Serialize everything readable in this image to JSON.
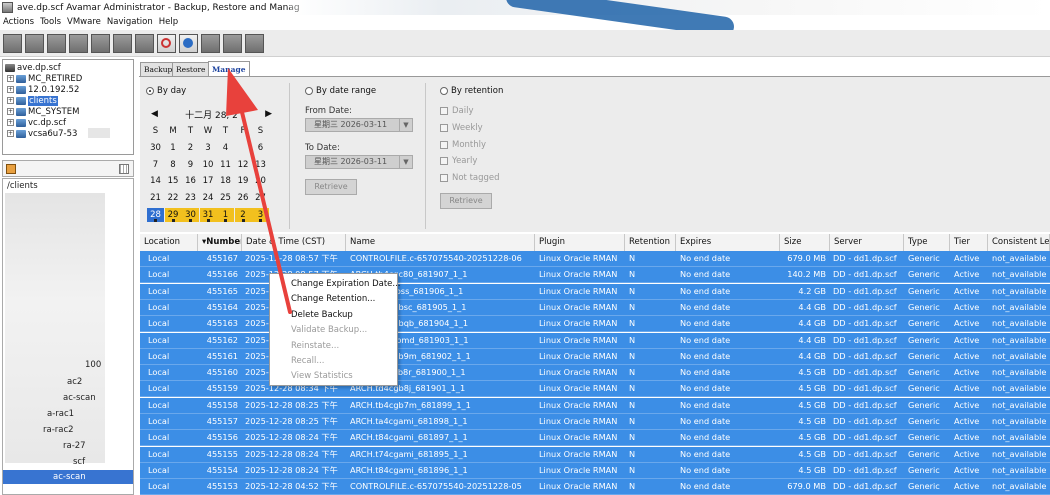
{
  "window": {
    "title": "ave.dp.scf Avamar Administrator - Backup, Restore and Manag"
  },
  "menu": [
    "Actions",
    "Tools",
    "VMware",
    "Navigation",
    "Help"
  ],
  "tree": {
    "root": "ave.dp.scf",
    "items": [
      "MC_RETIRED",
      "12.0.192.52",
      "clients",
      "MC_SYSTEM",
      "vc.dp.scf",
      "vcsa6u7-53"
    ]
  },
  "client_list": {
    "path": "/clients",
    "items": [
      "100",
      "ac2",
      "ac-scan",
      "a-rac1",
      "ra-rac2",
      "ra-27",
      "scf"
    ],
    "selected": "ac-scan"
  },
  "tabs": [
    "Backup",
    "Restore",
    "Manage"
  ],
  "by_day": {
    "label": "By day",
    "month_label": "十二月 28, 2",
    "weekdays": [
      "S",
      "M",
      "T",
      "W",
      "T",
      "F",
      "S"
    ],
    "weeks": [
      [
        "30",
        "1",
        "2",
        "3",
        "4",
        "",
        "6"
      ],
      [
        "7",
        "8",
        "9",
        "10",
        "11",
        "12",
        "13"
      ],
      [
        "14",
        "15",
        "16",
        "17",
        "18",
        "19",
        "20"
      ],
      [
        "21",
        "22",
        "23",
        "24",
        "25",
        "26",
        "27"
      ],
      [
        "28",
        "29",
        "30",
        "31",
        "1",
        "2",
        "3"
      ]
    ]
  },
  "by_date_range": {
    "label": "By date range",
    "from_label": "From Date:",
    "from_value": "星期三 2026-03-11",
    "to_label": "To Date:",
    "to_value": "星期三 2026-03-11",
    "retrieve": "Retrieve"
  },
  "by_retention": {
    "label": "By retention",
    "options": [
      "Daily",
      "Weekly",
      "Monthly",
      "Yearly",
      "Not tagged"
    ],
    "retrieve": "Retrieve"
  },
  "table": {
    "columns": [
      "Location",
      "Number",
      "Date & Time (CST)",
      "Name",
      "Plugin",
      "Retention",
      "Expires",
      "Size",
      "Server",
      "Type",
      "Tier",
      "Consistent Lev"
    ],
    "rows": [
      [
        "Local",
        "455167",
        "2025-12-28 08:57 下午",
        "CONTROLFILE.c-657075540-20251228-06",
        "Linux Oracle RMAN",
        "N",
        "No end date",
        "679.0 MB",
        "DD - dd1.dp.scf",
        "Generic",
        "Active",
        "not_available"
      ],
      [
        "Local",
        "455166",
        "2025-12-28 08:57 下午",
        "ARCH.tb4cgc80_681907_1_1",
        "Linux Oracle RMAN",
        "N",
        "No end date",
        "140.2 MB",
        "DD - dd1.dp.scf",
        "Generic",
        "Active",
        "not_available"
      ],
      [
        "Local",
        "455165",
        "2025-12-28 08:56 下午",
        "ARCH.ti4cgbss_681906_1_1",
        "Linux Oracle RMAN",
        "N",
        "No end date",
        "4.2 GB",
        "DD - dd1.dp.scf",
        "Generic",
        "Active",
        "not_available"
      ],
      [
        "Local",
        "455164",
        "2025-12-28 08:56 下午",
        "ARCH.th4cgbsc_681905_1_1",
        "Linux Oracle RMAN",
        "N",
        "No end date",
        "4.4 GB",
        "DD - dd1.dp.scf",
        "Generic",
        "Active",
        "not_available"
      ],
      [
        "Local",
        "455163",
        "2025-12-28 08:55 下午",
        "ARCH.tg4cgbqb_681904_1_1",
        "Linux Oracle RMAN",
        "N",
        "No end date",
        "4.4 GB",
        "DD - dd1.dp.scf",
        "Generic",
        "Active",
        "not_available"
      ],
      [
        "Local",
        "455162",
        "2025-12-28 08:54 下午",
        "ARCH.tf4cgbmd_681903_1_1",
        "Linux Oracle RMAN",
        "N",
        "No end date",
        "4.4 GB",
        "DD - dd1.dp.scf",
        "Generic",
        "Active",
        "not_available"
      ],
      [
        "Local",
        "455161",
        "2025-12-28 08:44 下午",
        "ARCH.te4cgb9m_681902_1_1",
        "Linux Oracle RMAN",
        "N",
        "No end date",
        "4.4 GB",
        "DD - dd1.dp.scf",
        "Generic",
        "Active",
        "not_available"
      ],
      [
        "Local",
        "455160",
        "2025-12-28 08:40 下午",
        "ARCH.tc4cgb8r_681900_1_1",
        "Linux Oracle RMAN",
        "N",
        "No end date",
        "4.5 GB",
        "DD - dd1.dp.scf",
        "Generic",
        "Active",
        "not_available"
      ],
      [
        "Local",
        "455159",
        "2025-12-28 08:34 下午",
        "ARCH.td4cgb8j_681901_1_1",
        "Linux Oracle RMAN",
        "N",
        "No end date",
        "4.5 GB",
        "DD - dd1.dp.scf",
        "Generic",
        "Active",
        "not_available"
      ],
      [
        "Local",
        "455158",
        "2025-12-28 08:25 下午",
        "ARCH.tb4cgb7m_681899_1_1",
        "Linux Oracle RMAN",
        "N",
        "No end date",
        "4.5 GB",
        "DD - dd1.dp.scf",
        "Generic",
        "Active",
        "not_available"
      ],
      [
        "Local",
        "455157",
        "2025-12-28 08:25 下午",
        "ARCH.ta4cgami_681898_1_1",
        "Linux Oracle RMAN",
        "N",
        "No end date",
        "4.5 GB",
        "DD - dd1.dp.scf",
        "Generic",
        "Active",
        "not_available"
      ],
      [
        "Local",
        "455156",
        "2025-12-28 08:24 下午",
        "ARCH.t84cgami_681897_1_1",
        "Linux Oracle RMAN",
        "N",
        "No end date",
        "4.5 GB",
        "DD - dd1.dp.scf",
        "Generic",
        "Active",
        "not_available"
      ],
      [
        "Local",
        "455155",
        "2025-12-28 08:24 下午",
        "ARCH.t74cgami_681895_1_1",
        "Linux Oracle RMAN",
        "N",
        "No end date",
        "4.5 GB",
        "DD - dd1.dp.scf",
        "Generic",
        "Active",
        "not_available"
      ],
      [
        "Local",
        "455154",
        "2025-12-28 08:24 下午",
        "ARCH.t84cgami_681896_1_1",
        "Linux Oracle RMAN",
        "N",
        "No end date",
        "4.5 GB",
        "DD - dd1.dp.scf",
        "Generic",
        "Active",
        "not_available"
      ],
      [
        "Local",
        "455153",
        "2025-12-28 04:52 下午",
        "CONTROLFILE.c-657075540-20251228-05",
        "Linux Oracle RMAN",
        "N",
        "No end date",
        "679.0 MB",
        "DD - dd1.dp.scf",
        "Generic",
        "Active",
        "not_available"
      ]
    ]
  },
  "context_menu": {
    "items": [
      {
        "label": "Change Expiration Date...",
        "enabled": true
      },
      {
        "label": "Change Retention...",
        "enabled": true
      },
      {
        "label": "Delete Backup",
        "enabled": true
      },
      {
        "label": "Validate Backup...",
        "enabled": false
      },
      {
        "label": "Reinstate...",
        "enabled": false
      },
      {
        "label": "Recall...",
        "enabled": false
      },
      {
        "label": "View Statistics",
        "enabled": false
      }
    ]
  },
  "colors": {
    "selection": "#3c8ee6",
    "calendar_highlight": "#f2c01e",
    "annotation_arrow": "#e8413c",
    "tab_active_text": "#2046a0"
  }
}
